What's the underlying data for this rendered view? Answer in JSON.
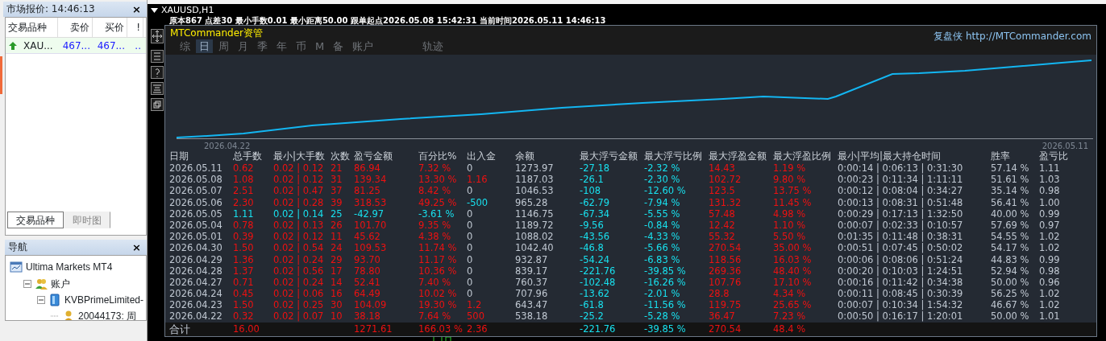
{
  "market_watch": {
    "title": "市场报价: 14:46:13",
    "close": "×",
    "columns": [
      "交易品种",
      "卖价",
      "买价",
      "!"
    ],
    "rows": [
      {
        "symbol": "XAU...",
        "bid": "467...",
        "ask": "467...",
        "spread": "..",
        "rising": true
      }
    ],
    "tabs": [
      {
        "label": "交易品种",
        "selected": true
      },
      {
        "label": "即时图",
        "selected": false
      }
    ]
  },
  "navigator": {
    "title": "导航",
    "close": "×",
    "tree": [
      {
        "label": "Ultima Markets MT4",
        "kind": "terminal",
        "children": [
          {
            "label": "账户",
            "kind": "accounts",
            "expanded": true,
            "children": [
              {
                "label": "KVBPrimeLimited-",
                "kind": "server",
                "expanded": true,
                "children": [
                  {
                    "label": "20044173: 周",
                    "kind": "user"
                  }
                ]
              }
            ]
          }
        ]
      }
    ]
  },
  "chart_window": {
    "title": "XAUUSD,H1",
    "info": "原本867  点差30  最小手数0.01  最小距离50.00  跟单起点2026.05.08 15:42:31  当前时间2026.05.11 14:46:13"
  },
  "panel": {
    "brand": "MTCommander资管",
    "site_label": "复盘侠",
    "site_url": "http://MTCommander.com",
    "tabs": [
      {
        "label": "综",
        "selected": false
      },
      {
        "label": "日",
        "selected": true
      },
      {
        "label": "周",
        "selected": false
      },
      {
        "label": "月",
        "selected": false
      },
      {
        "label": "季",
        "selected": false
      },
      {
        "label": "年",
        "selected": false
      },
      {
        "label": "币",
        "selected": false
      },
      {
        "label": "M",
        "selected": false
      },
      {
        "label": "备",
        "selected": false
      },
      {
        "label": "账户",
        "selected": false
      },
      {
        "label": "轨迹",
        "selected": false
      }
    ],
    "equity_chart": {
      "start_label": "2026.04.22",
      "end_label": "2026.05.11"
    },
    "table": {
      "columns": [
        "日期",
        "总手数",
        "最小|大手数",
        "次数",
        "盈亏金额",
        "百分比%",
        "出入金",
        "余额",
        "最大浮亏金额",
        "最大浮亏比例",
        "最大浮盈金额",
        "最大浮盈比例",
        "最小|平均|最大持仓时间",
        "胜率",
        "盈亏比"
      ],
      "rows": [
        {
          "loss": false,
          "cash_in": false,
          "cash_out": false,
          "cells": [
            "2026.05.11",
            "0.62",
            "0.02 | 0.12",
            "21",
            "86.94",
            "7.32 %",
            "0",
            "1273.97",
            "-27.18",
            "-2.32 %",
            "14.43",
            "1.19 %",
            "0:00:14 | 0:06:13 | 0:31:30",
            "57.14 %",
            "1.11"
          ]
        },
        {
          "loss": false,
          "cash_in": true,
          "cash_out": false,
          "cells": [
            "2026.05.08",
            "1.08",
            "0.02 | 0.12",
            "31",
            "139.34",
            "13.30 %",
            "1.16",
            "1187.03",
            "-26.1",
            "-2.30 %",
            "102.72",
            "9.80 %",
            "0:00:23 | 0:11:34 | 1:11:11",
            "51.61 %",
            "1.03"
          ]
        },
        {
          "loss": false,
          "cash_in": false,
          "cash_out": false,
          "cells": [
            "2026.05.07",
            "2.51",
            "0.02 | 0.47",
            "37",
            "81.25",
            "8.42 %",
            "0",
            "1046.53",
            "-108",
            "-12.60 %",
            "123.5",
            "13.75 %",
            "0:00:12 | 0:08:04 | 0:34:27",
            "35.14 %",
            "0.98"
          ]
        },
        {
          "loss": false,
          "cash_in": false,
          "cash_out": true,
          "cells": [
            "2026.05.06",
            "2.30",
            "0.02 | 0.28",
            "39",
            "318.53",
            "49.25 %",
            "-500",
            "965.28",
            "-62.79",
            "-7.94 %",
            "131.32",
            "11.45 %",
            "0:00:13 | 0:08:31 | 0:51:48",
            "56.41 %",
            "1.00"
          ]
        },
        {
          "loss": true,
          "cash_in": false,
          "cash_out": false,
          "cells": [
            "2026.05.05",
            "1.11",
            "0.02 | 0.14",
            "25",
            "-42.97",
            "-3.61 %",
            "0",
            "1146.75",
            "-67.34",
            "-5.55 %",
            "57.48",
            "4.98 %",
            "0:00:29 | 0:17:13 | 1:32:50",
            "40.00 %",
            "0.99"
          ]
        },
        {
          "loss": false,
          "cash_in": false,
          "cash_out": false,
          "cells": [
            "2026.05.04",
            "0.78",
            "0.02 | 0.13",
            "26",
            "101.70",
            "9.35 %",
            "0",
            "1189.72",
            "-9.56",
            "-0.84 %",
            "12.42",
            "1.10 %",
            "0:00:07 | 0:02:33 | 0:10:57",
            "57.69 %",
            "0.97"
          ]
        },
        {
          "loss": false,
          "cash_in": false,
          "cash_out": false,
          "cells": [
            "2026.05.01",
            "0.39",
            "0.02 | 0.12",
            "11",
            "45.62",
            "4.38 %",
            "0",
            "1088.02",
            "-43.56",
            "-4.33 %",
            "55.32",
            "5.50 %",
            "0:01:35 | 0:11:48 | 0:38:31",
            "54.55 %",
            "1.02"
          ]
        },
        {
          "loss": false,
          "cash_in": false,
          "cash_out": false,
          "cells": [
            "2026.04.30",
            "1.50",
            "0.02 | 0.54",
            "24",
            "109.53",
            "11.74 %",
            "0",
            "1042.40",
            "-46.8",
            "-5.66 %",
            "270.54",
            "35.00 %",
            "0:00:51 | 0:07:45 | 0:50:02",
            "54.17 %",
            "1.02"
          ]
        },
        {
          "loss": false,
          "cash_in": false,
          "cash_out": false,
          "cells": [
            "2026.04.29",
            "1.36",
            "0.02 | 0.24",
            "29",
            "93.70",
            "11.17 %",
            "0",
            "932.87",
            "-54.24",
            "-6.83 %",
            "118.56",
            "16.03 %",
            "0:00:06 | 0:08:06 | 0:51:24",
            "44.83 %",
            "0.99"
          ]
        },
        {
          "loss": false,
          "cash_in": false,
          "cash_out": false,
          "cells": [
            "2026.04.28",
            "1.37",
            "0.02 | 0.56",
            "17",
            "78.80",
            "10.36 %",
            "0",
            "839.17",
            "-221.76",
            "-39.85 %",
            "269.36",
            "48.40 %",
            "0:00:20 | 0:10:03 | 1:24:51",
            "52.94 %",
            "0.98"
          ]
        },
        {
          "loss": false,
          "cash_in": false,
          "cash_out": false,
          "cells": [
            "2026.04.27",
            "0.71",
            "0.02 | 0.24",
            "14",
            "52.41",
            "7.40 %",
            "0",
            "760.37",
            "-102.48",
            "-16.26 %",
            "107.76",
            "17.10 %",
            "0:00:16 | 0:11:42 | 0:34:38",
            "50.00 %",
            "0.96"
          ]
        },
        {
          "loss": false,
          "cash_in": false,
          "cash_out": false,
          "cells": [
            "2026.04.24",
            "0.45",
            "0.02 | 0.06",
            "16",
            "64.49",
            "10.02 %",
            "0",
            "707.96",
            "-13.62",
            "-2.01 %",
            "28.8",
            "4.34 %",
            "0:00:11 | 0:08:45 | 0:30:39",
            "56.25 %",
            "1.02"
          ]
        },
        {
          "loss": false,
          "cash_in": true,
          "cash_out": false,
          "cells": [
            "2026.04.23",
            "1.50",
            "0.02 | 0.25",
            "30",
            "104.09",
            "19.30 %",
            "1.2",
            "643.47",
            "-61.8",
            "-11.56 %",
            "119.75",
            "25.65 %",
            "0:00:07 | 0:10:34 | 1:54:32",
            "46.67 %",
            "1.02"
          ]
        },
        {
          "loss": false,
          "cash_in": true,
          "cash_out": false,
          "cells": [
            "2026.04.22",
            "0.32",
            "0.02 | 0.07",
            "10",
            "38.18",
            "7.64 %",
            "500",
            "538.18",
            "-25.2",
            "-5.28 %",
            "36.47",
            "7.23 %",
            "0:00:50 | 0:16:17 | 1:20:01",
            "50.00 %",
            "1.01"
          ]
        }
      ],
      "total": {
        "loss": false,
        "cash_in": true,
        "cash_out": false,
        "cells": [
          "合计",
          "16.00",
          "",
          "",
          "1271.61",
          "166.03 %",
          "2.36",
          "",
          "-221.76",
          "-39.85 %",
          "270.54",
          "48.4 %",
          "",
          "",
          ""
        ]
      }
    }
  }
}
